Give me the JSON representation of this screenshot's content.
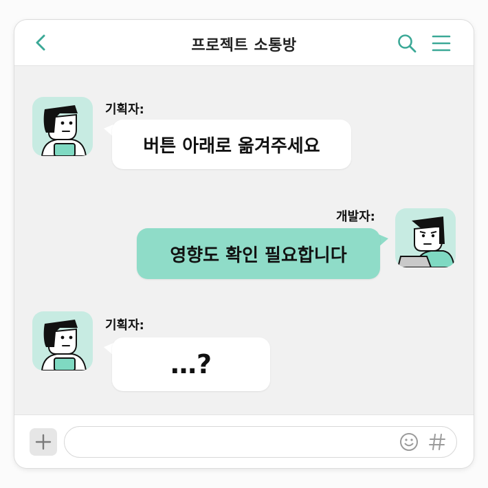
{
  "header": {
    "title": "프로젝트 소통방",
    "back_icon": "chevron-left-icon",
    "search_icon": "search-icon",
    "menu_icon": "hamburger-menu-icon"
  },
  "colors": {
    "accent": "#3aa896",
    "mint_bubble": "#8fdcc8",
    "avatar_bg": "#c7ebe2",
    "chat_bg": "#f1f1f1"
  },
  "messages": [
    {
      "sender": "기획자:",
      "text": "버튼 아래로 옮겨주세요",
      "side": "left"
    },
    {
      "sender": "개발자:",
      "text": "영향도 확인 필요합니다",
      "side": "right"
    },
    {
      "sender": "기획자:",
      "text": "…?",
      "side": "left"
    }
  ],
  "composer": {
    "value": "",
    "plus_icon": "plus-icon",
    "emoji_icon": "smiley-icon",
    "hash_icon": "hash-icon"
  }
}
